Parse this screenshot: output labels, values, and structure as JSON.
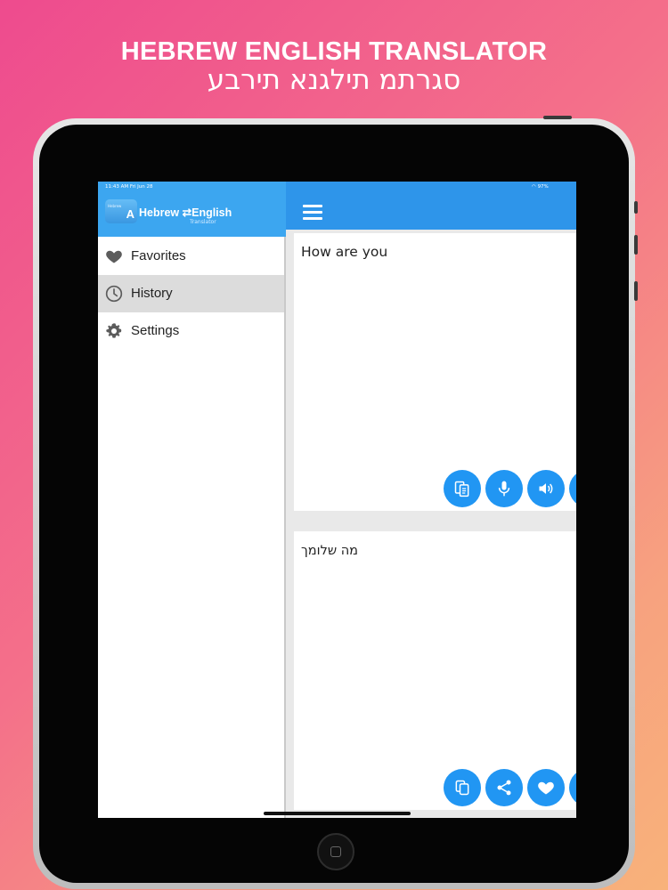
{
  "banner": {
    "title": "HEBREW ENGLISH TRANSLATOR",
    "subtitle": "סגרתמ תילגנא תירבע"
  },
  "status_bar": {
    "time": "11:43 AM   Fri Jun 28",
    "battery": "97%"
  },
  "sidebar": {
    "logo": {
      "badge_small": "Hebrew",
      "badge_letter": "A",
      "name": "Hebrew ⇄English",
      "tagline": "Translator"
    },
    "items": [
      {
        "label": "Favorites",
        "icon": "heart-icon",
        "selected": false
      },
      {
        "label": "History",
        "icon": "clock-icon",
        "selected": true
      },
      {
        "label": "Settings",
        "icon": "gear-icon",
        "selected": false
      }
    ]
  },
  "main": {
    "source_text": "How are you",
    "translated_text": "מה שלומך",
    "source_actions": [
      "paste-icon",
      "microphone-icon",
      "speaker-icon"
    ],
    "target_actions": [
      "copy-icon",
      "share-icon",
      "heart-icon"
    ]
  },
  "colors": {
    "sidebar_header": "#3ca6f0",
    "main_header": "#2e95ea",
    "action_button": "#2196f3",
    "selected_row": "#dcdcdc"
  }
}
